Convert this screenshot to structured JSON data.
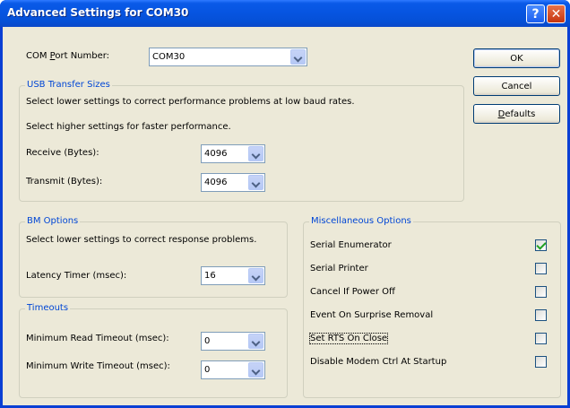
{
  "window": {
    "title": "Advanced Settings for COM30",
    "help_glyph": "?",
    "close_glyph": "✕"
  },
  "com_port": {
    "label": "COM Port Number:",
    "value": "COM30"
  },
  "usb": {
    "title": "USB Transfer Sizes",
    "desc1": "Select lower settings to correct performance problems at low baud rates.",
    "desc2": "Select higher settings for faster performance.",
    "receive_label": "Receive (Bytes):",
    "receive_value": "4096",
    "transmit_label": "Transmit (Bytes):",
    "transmit_value": "4096"
  },
  "bm": {
    "title": "BM Options",
    "desc": "Select lower settings to correct response problems.",
    "latency_label": "Latency Timer (msec):",
    "latency_value": "16"
  },
  "timeouts": {
    "title": "Timeouts",
    "read_label": "Minimum Read Timeout (msec):",
    "read_value": "0",
    "write_label": "Minimum Write Timeout (msec):",
    "write_value": "0"
  },
  "misc": {
    "title": "Miscellaneous Options",
    "items": [
      {
        "label": "Serial Enumerator",
        "checked": true
      },
      {
        "label": "Serial Printer",
        "checked": false
      },
      {
        "label": "Cancel If Power Off",
        "checked": false
      },
      {
        "label": "Event On Surprise Removal",
        "checked": false
      },
      {
        "label": "Set RTS On Close",
        "checked": false
      },
      {
        "label": "Disable Modem Ctrl At Startup",
        "checked": false
      }
    ]
  },
  "buttons": {
    "ok": "OK",
    "cancel": "Cancel",
    "defaults": "Defaults"
  }
}
